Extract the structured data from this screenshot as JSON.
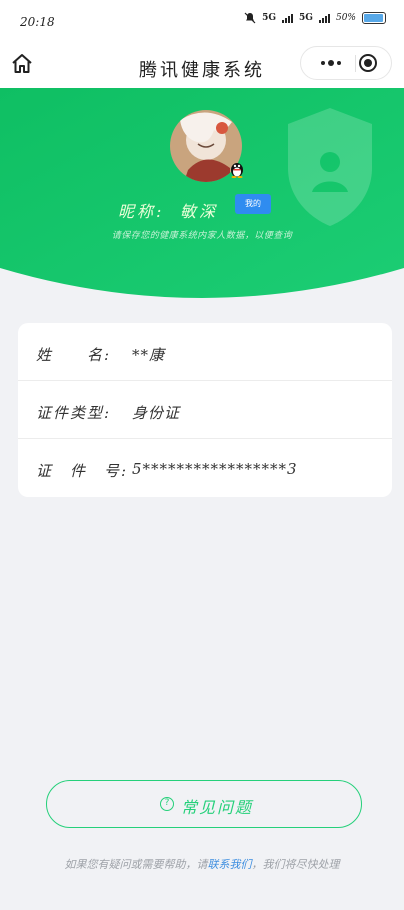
{
  "status_bar": {
    "time": "20:18",
    "network_1": "5G",
    "network_2": "5G",
    "battery": "50%",
    "colors": {
      "battery_fill": "#57a8e8"
    }
  },
  "nav": {
    "title": "腾讯健康系统",
    "home_icon": "home-icon",
    "more_icon": "more-dots-icon",
    "close_icon": "target-close-icon"
  },
  "profile": {
    "nickname_label": "昵称:",
    "nickname_value": "敏深",
    "my_button": "我的",
    "tip": "请保存您的健康系统内家人数据，以便查询"
  },
  "info": {
    "rows": [
      {
        "label": "姓　　名:",
        "value": "**康"
      },
      {
        "label": "证件类型:",
        "value": "身份证"
      },
      {
        "label": "证　件　号:",
        "value": "5*****************3"
      }
    ]
  },
  "feedback": {
    "label": "常见问题"
  },
  "footer": {
    "text_before": "如果您有疑问或需要帮助，请",
    "link": "联系我们",
    "text_after": "，我们将尽快处理"
  },
  "colors": {
    "hero_green": "#13c066",
    "accent_green": "#25d07a",
    "my_button_blue": "#2f8cf0",
    "background": "#f1f2f5"
  }
}
